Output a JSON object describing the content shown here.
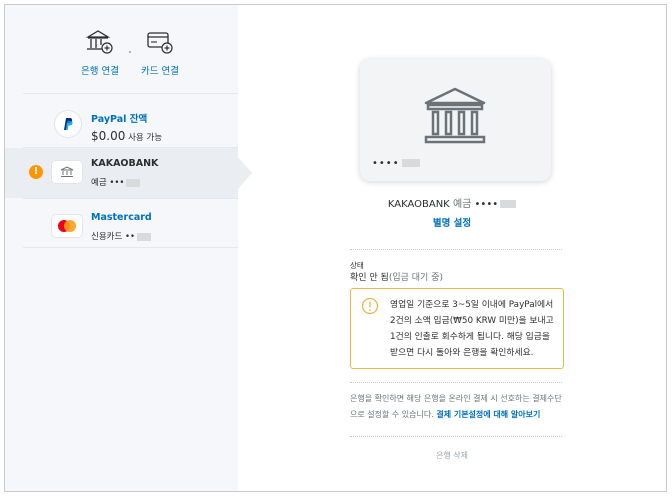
{
  "sidebar": {
    "link_bank_label": "은행 연결",
    "link_card_label": "카드 연결",
    "accounts": [
      {
        "name": "PayPal 잔액",
        "balance": "$0.00",
        "balance_suffix": "사용 가능"
      },
      {
        "name": "KAKAOBANK",
        "type": "예금",
        "masked": "•••"
      },
      {
        "name": "Mastercard",
        "type": "신용카드",
        "masked": "••"
      }
    ],
    "warning_mark": "!"
  },
  "main": {
    "card_number": "••••",
    "caption_bank": "KAKAOBANK",
    "caption_type": "예금",
    "caption_masked": "••••",
    "nickname_link": "별명 설정",
    "status_label": "상태",
    "status_value": "확인 안 됨",
    "status_detail": "(입금 대기 중)",
    "notice_text": "영업일 기준으로 3~5일 이내에 PayPal에서 2건의 소액 입금(₩50 KRW 미만)을 보내고 1건의 인출로 회수하게 됩니다. 해당 입금을 받으면 다시 돌아와 은행을 확인하세요.",
    "info_text": "은행을 확인하면 해당 은행을 온라인 결제 시 선호하는 결제수단으로 설정할 수 있습니다.",
    "info_link": "결제 기본설정에 대해 알아보기",
    "remove_link": "은행 삭제"
  },
  "colors": {
    "link": "#0070ba",
    "warning": "#ff9600",
    "notice_border": "#f0b44c",
    "sidebar_bg": "#f5f7fa"
  }
}
